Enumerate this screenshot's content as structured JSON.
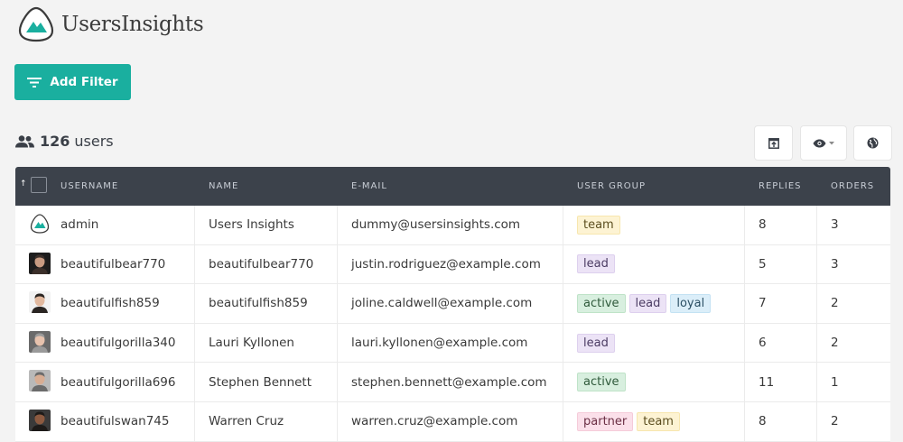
{
  "brand": {
    "name": "UsersInsights",
    "accent": "#1aaf9f"
  },
  "toolbar": {
    "add_filter_label": "Add Filter"
  },
  "summary": {
    "count": "126",
    "unit": "users"
  },
  "table": {
    "sort_indicator": "↑",
    "columns": [
      "USERNAME",
      "NAME",
      "E-MAIL",
      "USER GROUP",
      "REPLIES",
      "ORDERS"
    ],
    "rows": [
      {
        "username": "admin",
        "name": "Users Insights",
        "email": "dummy@usersinsights.com",
        "groups": [
          "team"
        ],
        "replies": "8",
        "orders": "3",
        "avatar": "logo-icon"
      },
      {
        "username": "beautifulbear770",
        "name": "beautifulbear770",
        "email": "justin.rodriguez@example.com",
        "groups": [
          "lead"
        ],
        "replies": "5",
        "orders": "3",
        "avatar": "photo"
      },
      {
        "username": "beautifulfish859",
        "name": "beautifulfish859",
        "email": "joline.caldwell@example.com",
        "groups": [
          "active",
          "lead",
          "loyal"
        ],
        "replies": "7",
        "orders": "2",
        "avatar": "photo"
      },
      {
        "username": "beautifulgorilla340",
        "name": "Lauri Kyllonen",
        "email": "lauri.kyllonen@example.com",
        "groups": [
          "lead"
        ],
        "replies": "6",
        "orders": "2",
        "avatar": "photo"
      },
      {
        "username": "beautifulgorilla696",
        "name": "Stephen Bennett",
        "email": "stephen.bennett@example.com",
        "groups": [
          "active"
        ],
        "replies": "11",
        "orders": "1",
        "avatar": "photo"
      },
      {
        "username": "beautifulswan745",
        "name": "Warren Cruz",
        "email": "warren.cruz@example.com",
        "groups": [
          "partner",
          "team"
        ],
        "replies": "8",
        "orders": "2",
        "avatar": "photo"
      }
    ]
  },
  "tools": [
    {
      "icon": "export-icon"
    },
    {
      "icon": "eye-dropdown-icon"
    },
    {
      "icon": "globe-icon"
    }
  ]
}
